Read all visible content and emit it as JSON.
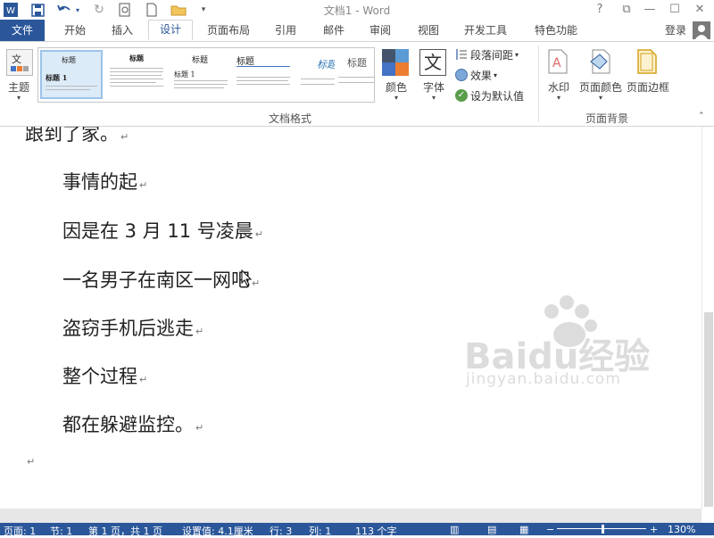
{
  "app": {
    "title": "文档1 - Word"
  },
  "window_controls": {
    "help": "?",
    "restore_ribbon": "⧉",
    "minimize": "—",
    "maximize": "☐",
    "close": "✕"
  },
  "account": {
    "login": "登录"
  },
  "tabs": [
    "文件",
    "开始",
    "插入",
    "设计",
    "页面布局",
    "引用",
    "邮件",
    "审阅",
    "视图",
    "开发工具",
    "特色功能"
  ],
  "ribbon": {
    "theme_label": "主题",
    "gallery": [
      {
        "heading": "标题",
        "subheading": "标题 1"
      },
      {
        "heading": "标题",
        "subheading": ""
      },
      {
        "heading": "标题",
        "subheading": "标题 1"
      },
      {
        "heading": "标题",
        "subheading": ""
      },
      {
        "heading": "标题",
        "subheading": ""
      },
      {
        "heading": "标题",
        "subheading": ""
      }
    ],
    "colors_label": "颜色",
    "fonts_label": "字体",
    "fonts_glyph": "文",
    "paragraph_spacing": "段落间距",
    "effects": "效果",
    "set_default": "设为默认值",
    "document_format_group": "文档格式",
    "watermark": "水印",
    "page_color": "页面颜色",
    "page_borders": "页面边框",
    "page_background_group": "页面背景"
  },
  "document": {
    "lines": [
      "跟到了家。",
      "事情的起",
      "因是在 3 月 11 号凌晨",
      "一名男子在南区一网吧",
      "盗窃手机后逃走",
      "整个过程",
      "都在躲避监控。"
    ],
    "paragraph_mark": "↵"
  },
  "watermark_text": {
    "brand": "Baidu经验",
    "url": "jingyan.baidu.com"
  },
  "status": {
    "page": "页面: 1",
    "section": "节: 1",
    "page_of": "第 1 页，共 1 页",
    "position": "设置值: 4.1厘米",
    "row": "行: 3",
    "column": "列: 1",
    "word_count": "113 个字",
    "zoom_minus": "−",
    "zoom_plus": "+",
    "zoom": "130%"
  },
  "colors": {
    "accent": "#2b579a"
  }
}
